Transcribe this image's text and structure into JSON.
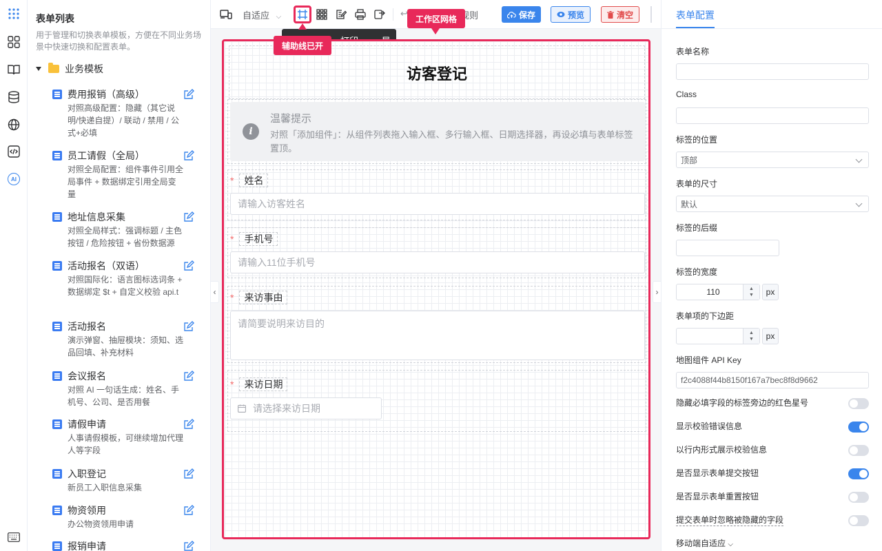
{
  "rail": {
    "ai_label": "AI"
  },
  "left_panel": {
    "title": "表单列表",
    "description": "用于管理和切换表单模板，方便在不同业务场景中快速切换和配置表单。",
    "folder": "业务模板",
    "items": [
      {
        "name": "费用报销（高级）",
        "desc": "对照高级配置：隐藏（其它说明/快递自提）/ 联动 / 禁用 / 公式+必填"
      },
      {
        "name": "员工请假（全局）",
        "desc": "对照全局配置：组件事件引用全局事件 + 数据绑定引用全局变量"
      },
      {
        "name": "地址信息采集",
        "desc": "对照全局样式：强调标题 / 主色按钮 / 危险按钮 + 省份数据源"
      },
      {
        "name": "活动报名（双语）",
        "desc": "对照国际化：语言图标选词条 + 数据绑定 $t + 自定义校验 api.t"
      },
      {
        "name": "活动报名",
        "desc": "演示弹窗、抽屉模块：须知、选品回填、补充材料"
      },
      {
        "name": "会议报名",
        "desc": "对照 AI 一句话生成：姓名、手机号、公司、是否用餐"
      },
      {
        "name": "请假申请",
        "desc": "人事请假模板，可继续增加代理人等字段"
      },
      {
        "name": "入职登记",
        "desc": "新员工入职信息采集"
      },
      {
        "name": "物资领用",
        "desc": "办公物资领用申请"
      },
      {
        "name": "报销申请",
        "desc": ""
      }
    ]
  },
  "toolbar": {
    "device_label": "自适应",
    "rules_label": "规则",
    "save_label": "保存",
    "preview_label": "预览",
    "clear_label": "清空",
    "tooltip_print": "打印",
    "tooltip_import": "导入",
    "tooltip_extra": "导"
  },
  "annotations": {
    "guides": "辅助线已开",
    "grid": "工作区网格"
  },
  "form": {
    "heading": "访客登记",
    "alert_title": "温馨提示",
    "alert_body": "对照「添加组件」：从组件列表拖入输入框、多行输入框、日期选择器，再设必填与表单标签置顶。",
    "fields": [
      {
        "label": "姓名",
        "placeholder": "请输入访客姓名"
      },
      {
        "label": "手机号",
        "placeholder": "请输入11位手机号"
      },
      {
        "label": "来访事由",
        "placeholder": "请简要说明来访目的"
      },
      {
        "label": "来访日期",
        "placeholder": "请选择来访日期"
      }
    ]
  },
  "right_panel": {
    "tab": "表单配置",
    "form_name_label": "表单名称",
    "form_name_value": "",
    "class_label": "Class",
    "class_value": "",
    "label_position_label": "标签的位置",
    "label_position_value": "顶部",
    "size_label": "表单的尺寸",
    "size_value": "默认",
    "suffix_label": "标签的后缀",
    "label_width_label": "标签的宽度",
    "label_width_value": "110",
    "label_width_unit": "px",
    "item_margin_label": "表单项的下边距",
    "item_margin_unit": "px",
    "apikey_label": "地图组件 API Key",
    "apikey_value": "f2c4088f44b8150f167a7bec8f8d9662",
    "toggles": [
      {
        "label": "隐藏必填字段的标签旁边的红色星号",
        "on": false
      },
      {
        "label": "显示校验错误信息",
        "on": true
      },
      {
        "label": "以行内形式展示校验信息",
        "on": false
      },
      {
        "label": "是否显示表单提交按钮",
        "on": true
      },
      {
        "label": "是否显示表单重置按钮",
        "on": false
      },
      {
        "label": "提交表单时忽略被隐藏的字段",
        "on": false
      }
    ],
    "mobile_label": "移动端自适应"
  },
  "colors": {
    "accent": "#3a85ec",
    "annotation": "#e8295a",
    "danger": "#e14b4b"
  }
}
